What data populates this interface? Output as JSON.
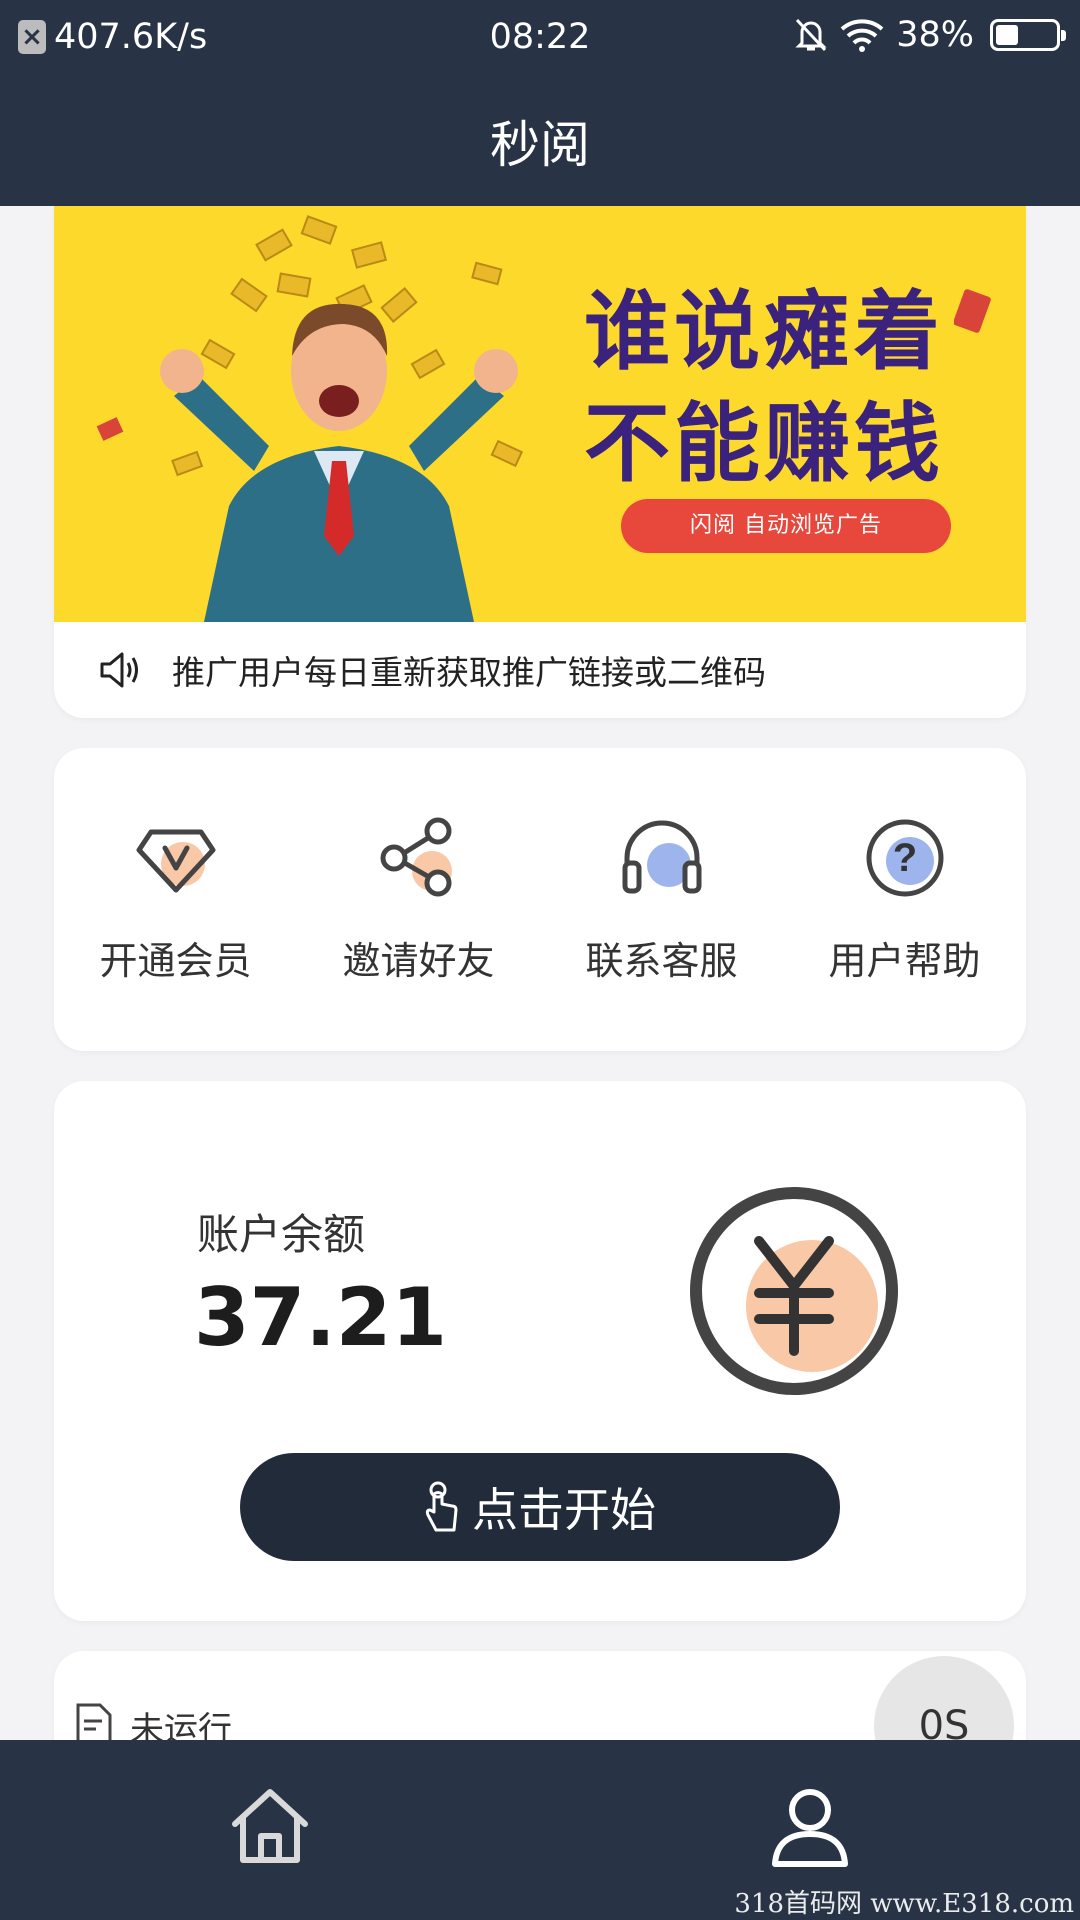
{
  "status_bar": {
    "network_speed": "407.6K/s",
    "time": "08:22",
    "battery": "38%",
    "battery_level": 0.38,
    "icons": [
      "network-blocked-icon",
      "mute-bell-icon",
      "wifi-icon",
      "battery-icon"
    ]
  },
  "header": {
    "title": "秒阅"
  },
  "banner": {
    "headline_line1": "谁说瘫着",
    "headline_line2": "不能赚钱",
    "pill": "闪阅 自动浏览广告"
  },
  "notice": {
    "text": "推广用户每日重新获取推广链接或二维码",
    "icon": "speaker-icon"
  },
  "menu": {
    "items": [
      {
        "label": "开通会员",
        "icon": "vip-icon"
      },
      {
        "label": "邀请好友",
        "icon": "share-icon"
      },
      {
        "label": "联系客服",
        "icon": "headset-icon"
      },
      {
        "label": "用户帮助",
        "icon": "help-icon"
      }
    ]
  },
  "balance": {
    "label": "账户余额",
    "value": "37.21",
    "icon": "yuan-icon",
    "start_button": "点击开始"
  },
  "task_status": {
    "text": "未运行",
    "badge": "0S"
  },
  "bottom_nav": {
    "items": [
      {
        "icon": "home-icon"
      },
      {
        "icon": "user-icon"
      }
    ]
  },
  "watermark": "318首码网 www.E318.com",
  "colors": {
    "dark": "#283445",
    "banner_yellow": "#fdd92c",
    "accent_peach": "#f9c8a6",
    "accent_blue": "#9db5ec"
  }
}
